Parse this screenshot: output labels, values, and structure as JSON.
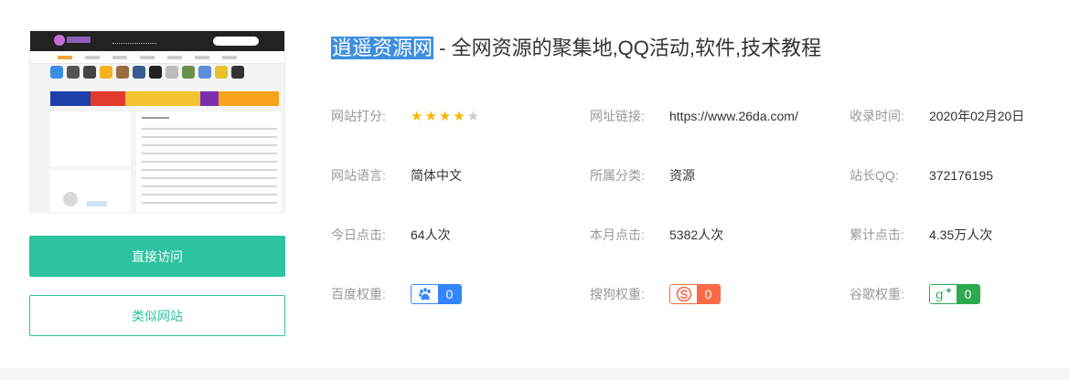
{
  "site": {
    "name": "逍遥资源网",
    "tagline": " - 全网资源的聚集地,QQ活动,软件,技术教程"
  },
  "buttons": {
    "visit": "直接访问",
    "similar": "类似网站"
  },
  "info": {
    "rating": {
      "label": "网站打分:",
      "stars": 4,
      "max": 5
    },
    "url": {
      "label": "网址链接:",
      "value": "https://www.26da.com/"
    },
    "added": {
      "label": "收录时间:",
      "value": "2020年02月20日"
    },
    "language": {
      "label": "网站语言:",
      "value": "简体中文"
    },
    "category": {
      "label": "所属分类:",
      "value": "资源"
    },
    "qq": {
      "label": "站长QQ:",
      "value": "372176195"
    },
    "today": {
      "label": "今日点击:",
      "value": "64人次"
    },
    "month": {
      "label": "本月点击:",
      "value": "5382人次"
    },
    "total": {
      "label": "累计点击:",
      "value": "4.35万人次"
    },
    "baidu": {
      "label": "百度权重:",
      "value": "0",
      "icon": "baidu-paw-icon",
      "color": "#3385ff"
    },
    "sogou": {
      "label": "搜狗权重:",
      "value": "0",
      "icon": "sogou-icon",
      "color": "#fb6a47"
    },
    "google": {
      "label": "谷歌权重:",
      "value": "0",
      "icon": "google-plus-icon",
      "color": "#2da94f"
    }
  },
  "colors": {
    "accent": "#2dc3a1",
    "highlight": "#3d8fe0",
    "star": "#f5b700"
  }
}
